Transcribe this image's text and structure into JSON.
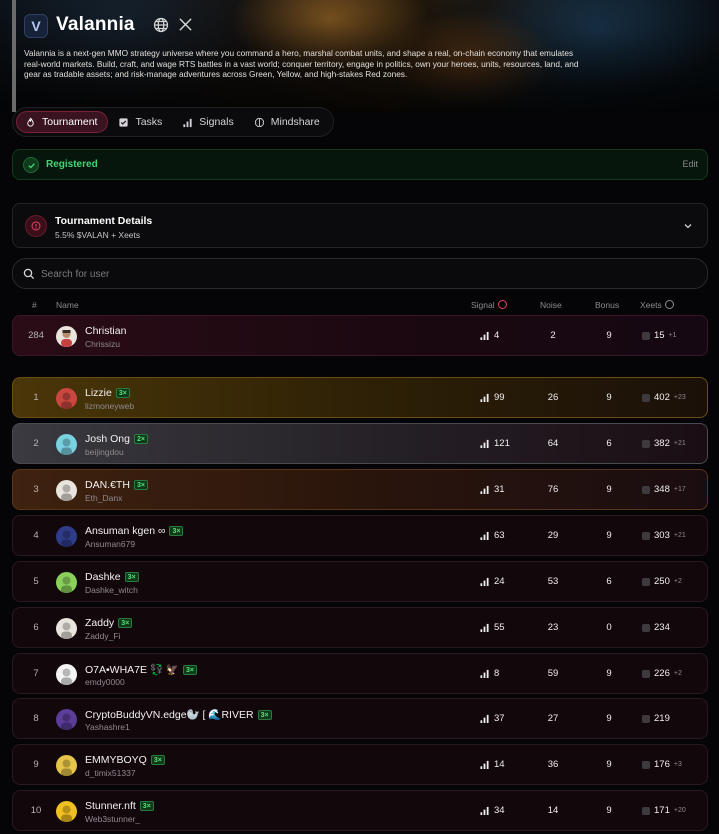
{
  "project": {
    "title": "Valannia",
    "logo_letter": "V",
    "description": "Valannia is a next-gen MMO strategy universe where you command a hero, marshal combat units, and shape a real, on-chain economy that emulates real-world markets. Build, craft, and wage RTS battles in a vast world; conquer territory, engage in politics, own your heroes, units, resources, land, and gear as tradable assets; and risk-manage adventures across Green, Yellow, and high-stakes Red zones."
  },
  "tabs": [
    {
      "label": "Tournament",
      "icon": "flame-icon",
      "active": true
    },
    {
      "label": "Tasks",
      "icon": "checkbox-icon",
      "active": false
    },
    {
      "label": "Signals",
      "icon": "bar-signal-icon",
      "active": false
    },
    {
      "label": "Mindshare",
      "icon": "brain-icon",
      "active": false
    }
  ],
  "registration": {
    "label": "Registered",
    "edit_label": "Edit"
  },
  "tournament": {
    "title": "Tournament Details",
    "subtitle": "5.5% $VALAN + Xeets"
  },
  "search": {
    "placeholder": "Search for user"
  },
  "columns": {
    "rank": "#",
    "name": "Name",
    "signal": "Signal",
    "noise": "Noise",
    "bonus": "Bonus",
    "xeets": "Xeets"
  },
  "colors": {
    "accent": "#7a2038",
    "success": "#3fd870",
    "gold": "#c9a227",
    "silver": "#9aa0a8",
    "bronze": "#b0673a"
  },
  "current_user": {
    "rank": "284",
    "name": "Christian",
    "handle": "Chrissizu",
    "signal": "4",
    "noise": "2",
    "bonus": "9",
    "xeets": "15",
    "delta": "+1"
  },
  "leaderboard": [
    {
      "rank": "1",
      "name": "Lizzie",
      "multiplier": "3×",
      "handle": "lizmoneyweb",
      "signal": "99",
      "noise": "26",
      "bonus": "9",
      "xeets": "402",
      "delta": "+23"
    },
    {
      "rank": "2",
      "name": "Josh Ong",
      "multiplier": "2×",
      "handle": "beijingdou",
      "signal": "121",
      "noise": "64",
      "bonus": "6",
      "xeets": "382",
      "delta": "+21"
    },
    {
      "rank": "3",
      "name": "DAN.€TH",
      "multiplier": "3×",
      "handle": "Eth_Danx",
      "signal": "31",
      "noise": "76",
      "bonus": "9",
      "xeets": "348",
      "delta": "+17"
    },
    {
      "rank": "4",
      "name": "Ansuman kgen ∞",
      "multiplier": "3×",
      "handle": "Ansuman679",
      "signal": "63",
      "noise": "29",
      "bonus": "9",
      "xeets": "303",
      "delta": "+21"
    },
    {
      "rank": "5",
      "name": "Dashke",
      "multiplier": "3×",
      "handle": "Dashke_witch",
      "signal": "24",
      "noise": "53",
      "bonus": "6",
      "xeets": "250",
      "delta": "+2"
    },
    {
      "rank": "6",
      "name": "Zaddy",
      "multiplier": "3×",
      "handle": "Zaddy_Fi",
      "signal": "55",
      "noise": "23",
      "bonus": "0",
      "xeets": "234",
      "delta": ""
    },
    {
      "rank": "7",
      "name": "O7A•WHA7E 💱 🦅",
      "multiplier": "3×",
      "handle": "emdy0000",
      "signal": "8",
      "noise": "59",
      "bonus": "9",
      "xeets": "226",
      "delta": "+2"
    },
    {
      "rank": "8",
      "name": "CryptoBuddyVN.edge🦭 [ 🌊RIVER",
      "multiplier": "3×",
      "handle": "Yashashre1",
      "signal": "37",
      "noise": "27",
      "bonus": "9",
      "xeets": "219",
      "delta": ""
    },
    {
      "rank": "9",
      "name": "EMMYBOYQ",
      "multiplier": "3×",
      "handle": "d_timix51337",
      "signal": "14",
      "noise": "36",
      "bonus": "9",
      "xeets": "176",
      "delta": "+3"
    },
    {
      "rank": "10",
      "name": "Stunner.nft",
      "multiplier": "3×",
      "handle": "Web3stunner_",
      "signal": "34",
      "noise": "14",
      "bonus": "9",
      "xeets": "171",
      "delta": "+20"
    }
  ]
}
